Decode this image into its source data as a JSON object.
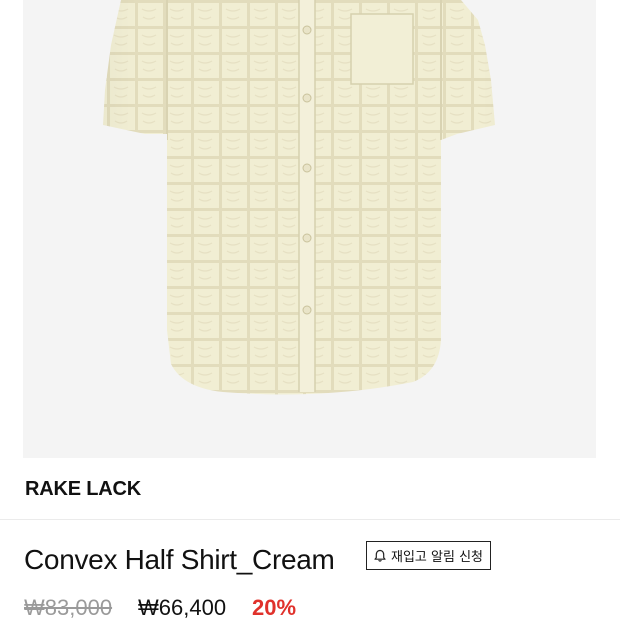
{
  "product": {
    "image_alt": "cream textured half-sleeve shirt",
    "brand": "RAKE LACK",
    "title": "Convex Half Shirt_Cream",
    "restock_button_label": "재입고 알림 신청",
    "restock_icon": "bell-icon",
    "original_price": "₩83,000",
    "sale_price": "₩66,400",
    "discount": "20%"
  },
  "colors": {
    "discount": "#e0312b",
    "shirt": "#f2efd6",
    "image_background": "#f4f4f4",
    "original_price": "#9a9a9a"
  }
}
